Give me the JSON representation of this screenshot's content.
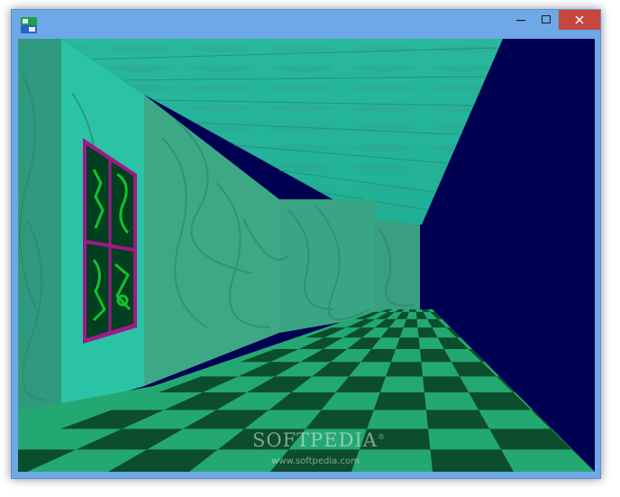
{
  "window": {
    "title": "",
    "controls": {
      "minimize": "minimize-icon",
      "maximize": "maximize-icon",
      "close": "close-icon"
    }
  },
  "scene": {
    "description_icon": "3d-corridor-viewport",
    "colors": {
      "ceiling": "#21b49b",
      "wall": "#3aa88c",
      "wall_light": "#2fbfa3",
      "void": "#000052",
      "floor_light": "#24a873",
      "floor_dark": "#0b4d2c",
      "frame": "#a0188a",
      "art_bg": "#003f1f",
      "art_glyph": "#12c22b"
    }
  },
  "watermark": {
    "logo": "SOFTPEDIA",
    "trademark": "®",
    "url": "www.softpedia.com"
  }
}
